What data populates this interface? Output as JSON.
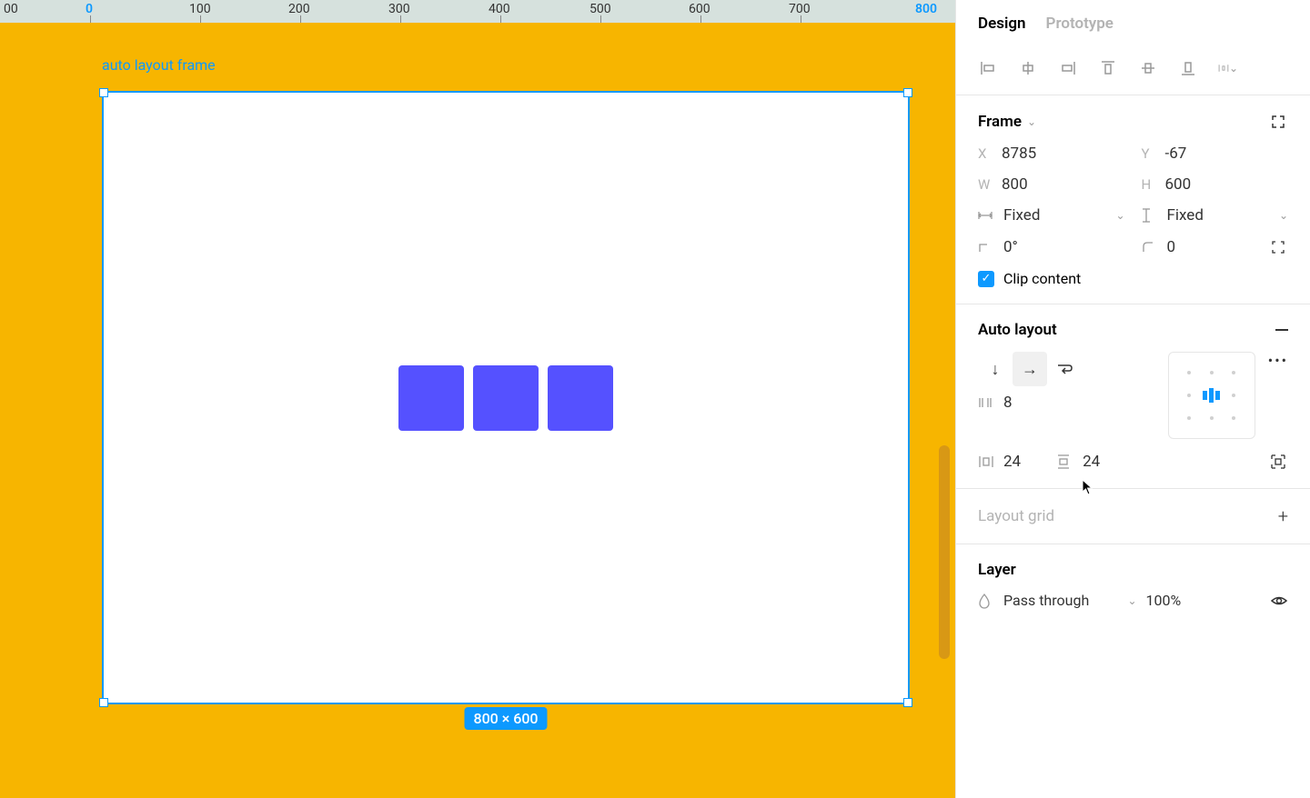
{
  "tabs": {
    "design": "Design",
    "prototype": "Prototype"
  },
  "ruler": {
    "ticks": [
      {
        "v": "00",
        "active": false
      },
      {
        "v": "0",
        "active": true
      },
      {
        "v": "100",
        "active": false
      },
      {
        "v": "200",
        "active": false
      },
      {
        "v": "300",
        "active": false
      },
      {
        "v": "400",
        "active": false
      },
      {
        "v": "500",
        "active": false
      },
      {
        "v": "600",
        "active": false
      },
      {
        "v": "700",
        "active": false
      },
      {
        "v": "800",
        "active": true
      }
    ]
  },
  "canvas": {
    "frame_label": "auto layout frame",
    "dimensions": "800 × 600"
  },
  "frame": {
    "title": "Frame",
    "x_label": "X",
    "x": "8785",
    "y_label": "Y",
    "y": "-67",
    "w_label": "W",
    "w": "800",
    "h_label": "H",
    "h": "600",
    "hsize": "Fixed",
    "vsize": "Fixed",
    "rotation": "0°",
    "radius": "0",
    "clip_label": "Clip content"
  },
  "auto_layout": {
    "title": "Auto layout",
    "gap": "8",
    "pad_h": "24",
    "pad_v": "24"
  },
  "layout_grid": {
    "title": "Layout grid"
  },
  "layer": {
    "title": "Layer",
    "blend": "Pass through",
    "opacity": "100%"
  }
}
